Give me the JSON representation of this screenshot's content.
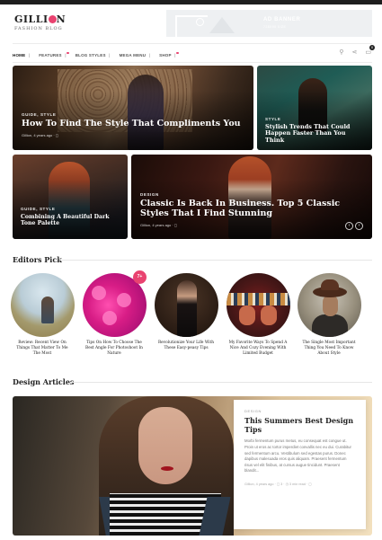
{
  "logo": {
    "main_prefix": "GILLI",
    "main_suffix": "N",
    "sub": "FASHION BLOG"
  },
  "ad": {
    "title": "AD BANNER",
    "sub": "728X90 SIZE"
  },
  "nav": {
    "items": [
      {
        "label": "HOME",
        "dot": false
      },
      {
        "label": "FEATURES",
        "dot": true
      },
      {
        "label": "BLOG STYLES",
        "dot": false
      },
      {
        "label": "MEGA MENU",
        "dot": false
      },
      {
        "label": "SHOP",
        "dot": true
      }
    ],
    "separator": "|",
    "cart_count": "0"
  },
  "featured": [
    {
      "category": "GUIDE, STYLE",
      "title": "How To Find The Style That Compliments You",
      "meta": "Gillion, 4 years ago  ·  ◻"
    },
    {
      "category": "STYLE",
      "title": "Stylish Trends That Could Happen Faster Than You Think",
      "meta": ""
    },
    {
      "category": "GUIDE, STYLE",
      "title": "Combining A Beautiful Dark Tone Palette",
      "meta": ""
    },
    {
      "category": "DESIGN",
      "title": "Classic Is Back In Business. Top 5 Classic Styles That I Find Stunning",
      "meta": "Gillion, 4 years ago  ·  ◻"
    }
  ],
  "editors_pick": {
    "heading": "Editors Pick",
    "badge": "7+",
    "items": [
      {
        "title": "Review: Recent View On Things That Matter To Me The Most"
      },
      {
        "title": "Tips On How To Choose The Best Angle For Photoshoot In Nature"
      },
      {
        "title": "Revolutionize Your Life With These Easy-peasy Tips"
      },
      {
        "title": "My Favorite Ways To Spend A Nice And Cozy Evening With Limited Budget"
      },
      {
        "title": "The Single Most Important Thing You Need To Know About Style"
      }
    ]
  },
  "design_articles": {
    "heading": "Design Articles",
    "category": "DESIGN",
    "title": "This Summers Best Design Tips",
    "excerpt": "Morbi fermentum purus metus, eu consequat est congue ut. Proin ut eros ac tortor imperdiet convallis nec eu dui. Curabitur sed fermentum arcu. Vestibulum sed egestas purus. Donec dapibus malesuada eros quis aliquam. Praesent fermentum risus vel elit finibus, at cursus augue tincidunt. Praesent blandit...",
    "meta": "Gillion, 4 years ago  ·  ◻ 3  ·  ◷ 3 min read  ·  ◻"
  },
  "arrows": {
    "prev": "‹",
    "next": "›"
  }
}
